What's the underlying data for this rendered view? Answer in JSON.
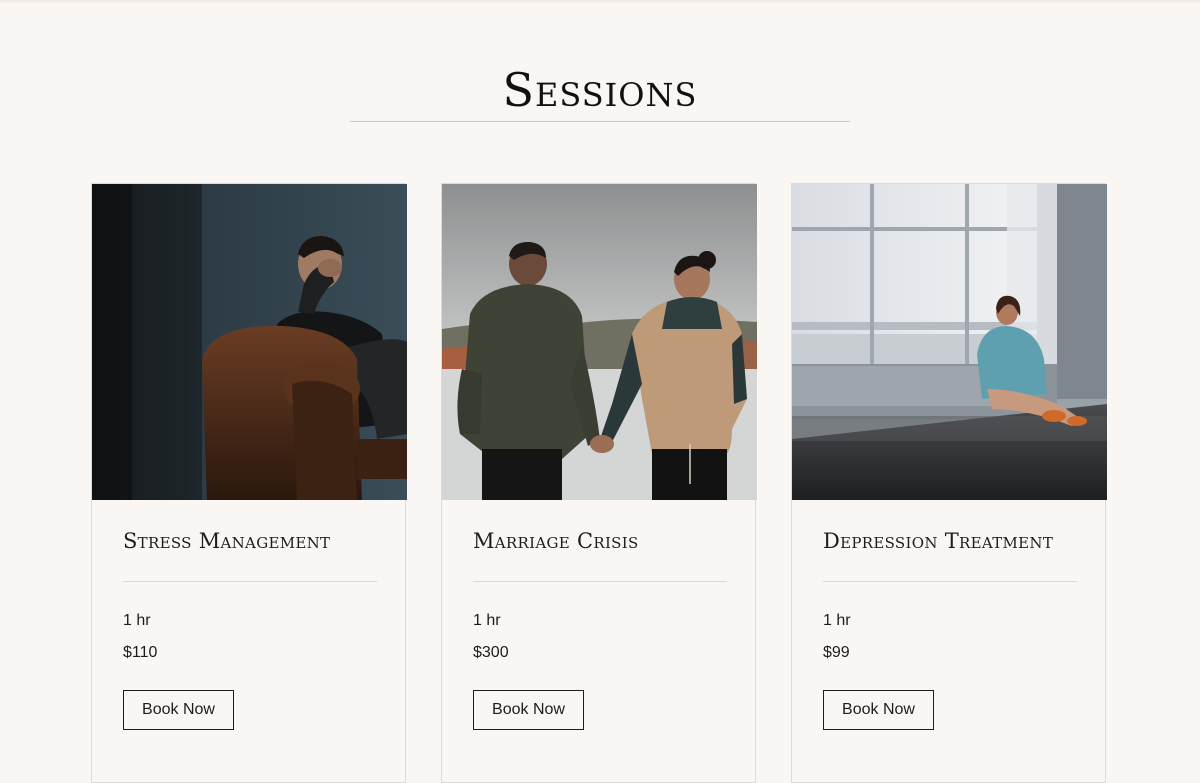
{
  "page": {
    "title": "Sessions"
  },
  "colors": {
    "background": "#faf6f3",
    "text": "#1d1d1d",
    "divider": "#dcd8d5"
  },
  "sessions": [
    {
      "title": "Stress Management",
      "duration": "1 hr",
      "price": "$110",
      "button_label": "Book Now",
      "image": "man-in-leather-armchair-photo"
    },
    {
      "title": "Marriage Crisis",
      "duration": "1 hr",
      "price": "$300",
      "button_label": "Book Now",
      "image": "couple-holding-hands-by-lake-photo"
    },
    {
      "title": "Depression Treatment",
      "duration": "1 hr",
      "price": "$99",
      "button_label": "Book Now",
      "image": "woman-sitting-by-window-photo"
    }
  ]
}
